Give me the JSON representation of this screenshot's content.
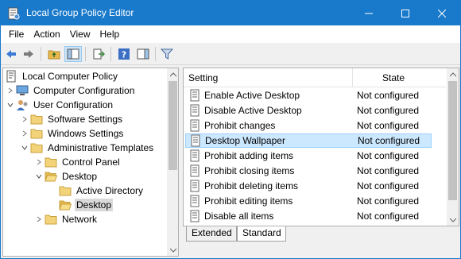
{
  "window": {
    "title": "Local Group Policy Editor",
    "colors": {
      "titlebar": "#1979ca",
      "selection": "#cce8ff"
    }
  },
  "menu": {
    "items": [
      "File",
      "Action",
      "View",
      "Help"
    ]
  },
  "toolbar": {
    "icons": [
      "back-arrow-icon",
      "forward-arrow-icon",
      "up-folder-icon",
      "show-hide-tree-icon",
      "export-list-icon",
      "help-icon",
      "show-hide-action-pane-icon",
      "filter-icon"
    ]
  },
  "tree": {
    "items": [
      {
        "label": "Local Computer Policy",
        "level": 0,
        "icon": "computer-policy-icon",
        "expander": ""
      },
      {
        "label": "Computer Configuration",
        "level": 1,
        "icon": "computer-icon",
        "expander": "collapsed"
      },
      {
        "label": "User Configuration",
        "level": 1,
        "icon": "user-icon",
        "expander": "expanded"
      },
      {
        "label": "Software Settings",
        "level": 2,
        "icon": "folder-icon",
        "expander": "collapsed"
      },
      {
        "label": "Windows Settings",
        "level": 2,
        "icon": "folder-icon",
        "expander": "collapsed"
      },
      {
        "label": "Administrative Templates",
        "level": 2,
        "icon": "folder-icon",
        "expander": "expanded"
      },
      {
        "label": "Control Panel",
        "level": 3,
        "icon": "folder-icon",
        "expander": "collapsed"
      },
      {
        "label": "Desktop",
        "level": 3,
        "icon": "folder-open-icon",
        "expander": "expanded"
      },
      {
        "label": "Active Directory",
        "level": 4,
        "icon": "folder-icon",
        "expander": ""
      },
      {
        "label": "Desktop",
        "level": 4,
        "icon": "folder-open-icon",
        "expander": "",
        "selected": true
      },
      {
        "label": "Network",
        "level": 3,
        "icon": "folder-icon",
        "expander": "collapsed"
      }
    ]
  },
  "list": {
    "columns": {
      "setting": "Setting",
      "state": "State"
    },
    "rows": [
      {
        "name": "Enable Active Desktop",
        "state": "Not configured"
      },
      {
        "name": "Disable Active Desktop",
        "state": "Not configured"
      },
      {
        "name": "Prohibit changes",
        "state": "Not configured"
      },
      {
        "name": "Desktop Wallpaper",
        "state": "Not configured",
        "selected": true
      },
      {
        "name": "Prohibit adding items",
        "state": "Not configured"
      },
      {
        "name": "Prohibit closing items",
        "state": "Not configured"
      },
      {
        "name": "Prohibit deleting items",
        "state": "Not configured"
      },
      {
        "name": "Prohibit editing items",
        "state": "Not configured"
      },
      {
        "name": "Disable all items",
        "state": "Not configured"
      }
    ]
  },
  "tabs": {
    "extended": "Extended",
    "standard": "Standard",
    "active": "Standard"
  }
}
